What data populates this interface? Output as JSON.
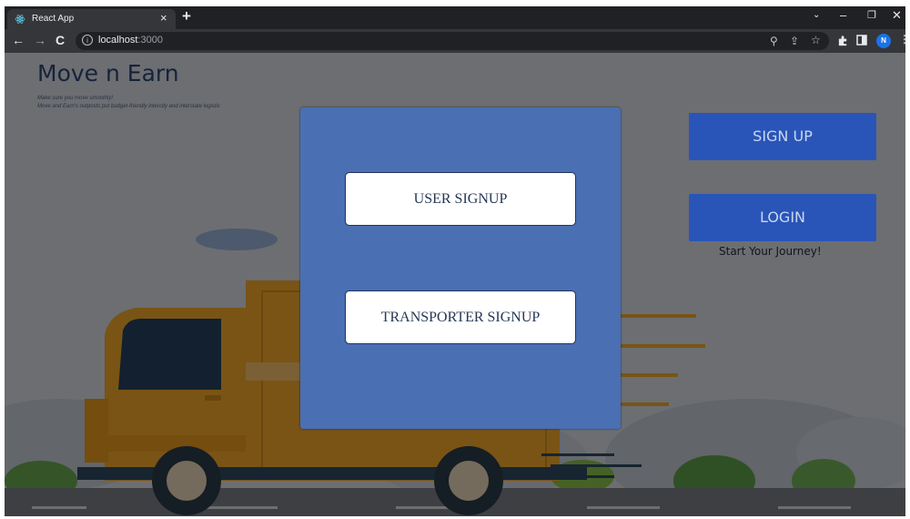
{
  "browser": {
    "tab_title": "React App",
    "tab_close": "×",
    "new_tab": "+",
    "url_host": "localhost",
    "url_port": ":3000",
    "profile_initial": "N",
    "icons": [
      "back-arrow-icon",
      "forward-arrow-icon",
      "reload-icon",
      "info-icon",
      "zoom-icon",
      "share-icon",
      "bookmark-star-icon",
      "extensions-icon",
      "side-panel-icon",
      "menu-dots-icon"
    ]
  },
  "site": {
    "title": "Move n Earn",
    "tagline": "Make sure you move smoothly!",
    "description": "Move and Earn's outposts put budget-friendly intercity and interstate logistic"
  },
  "auth": {
    "signup_label": "SIGN UP",
    "login_label": "LOGIN",
    "journey_text": "Start Your Journey!"
  },
  "modal": {
    "user_signup_label": "USER SIGNUP",
    "transporter_signup_label": "TRANSPORTER SIGNUP"
  },
  "colors": {
    "modal_bg": "#4a6fb3",
    "cta_bg": "#2a55b8",
    "truck": "#f2a92b",
    "avatar": "#1a73e8"
  }
}
